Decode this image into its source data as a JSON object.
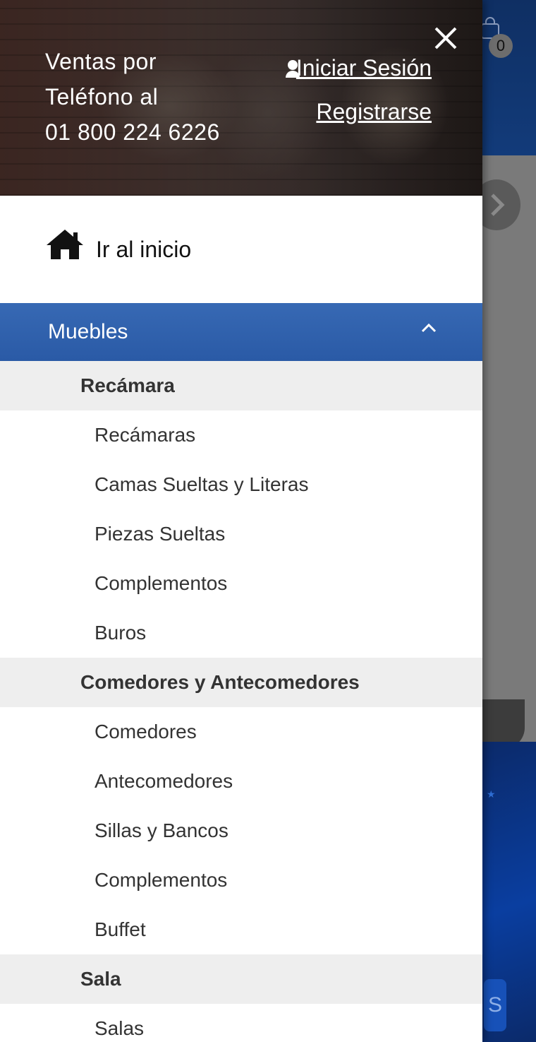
{
  "background": {
    "cart_count": "0",
    "tile_letter": "S"
  },
  "drawer": {
    "phone_lines": [
      "Ventas por",
      "Teléfono al",
      "01 800 224 6226"
    ],
    "login_label": "Iniciar Sesión",
    "register_label": "Registrarse",
    "home_label": "Ir al inicio",
    "category": {
      "label": "Muebles",
      "groups": [
        {
          "title": "Recámara",
          "items": [
            "Recámaras",
            "Camas Sueltas y Literas",
            "Piezas Sueltas",
            "Complementos",
            "Buros"
          ]
        },
        {
          "title": "Comedores y Antecomedores",
          "items": [
            "Comedores",
            "Antecomedores",
            "Sillas y Bancos",
            "Complementos",
            "Buffet"
          ]
        },
        {
          "title": "Sala",
          "items": [
            "Salas"
          ]
        }
      ]
    }
  },
  "colors": {
    "accent_blue": "#2f5faf",
    "submenu_bg": "#eeeeee"
  },
  "icons": {
    "close": "close-icon",
    "user": "user-icon",
    "home": "home-icon",
    "chevron": "chevron-up-icon",
    "cart": "cart-icon",
    "next": "chevron-right-icon"
  }
}
